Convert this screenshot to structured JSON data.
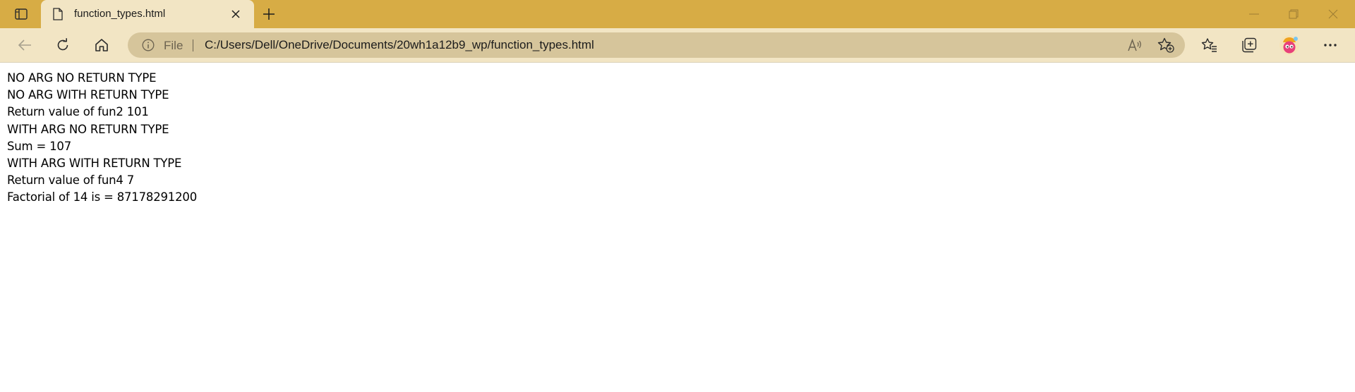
{
  "browser": {
    "tab": {
      "title": "function_types.html"
    },
    "address_bar": {
      "scheme_label": "File",
      "url": "C:/Users/Dell/OneDrive/Documents/20wh1a12b9_wp/function_types.html"
    },
    "accent_color": "#d7ac45",
    "toolbar_color": "#f2e5c4",
    "icons": {
      "tab_actions": "tab-actions-icon",
      "favicon": "document-icon",
      "tab_close": "close-icon",
      "new_tab": "plus-icon",
      "minimize": "minimize-icon",
      "restore": "restore-icon",
      "window_close": "close-icon",
      "back": "arrow-left-icon",
      "refresh": "refresh-icon",
      "home": "home-icon",
      "site_info": "info-icon",
      "read_aloud": "read-aloud-icon",
      "add_favorite": "star-plus-icon",
      "favorites": "favorites-icon",
      "collections": "collections-icon",
      "profile": "profile-avatar-icon",
      "menu": "more-icon"
    }
  },
  "page": {
    "lines": [
      "NO ARG NO RETURN TYPE",
      "NO ARG WITH RETURN TYPE",
      "Return value of fun2 101",
      "WITH ARG NO RETURN TYPE",
      "Sum = 107",
      "WITH ARG WITH RETURN TYPE",
      "Return value of fun4 7",
      "Factorial of 14 is = 87178291200"
    ]
  }
}
